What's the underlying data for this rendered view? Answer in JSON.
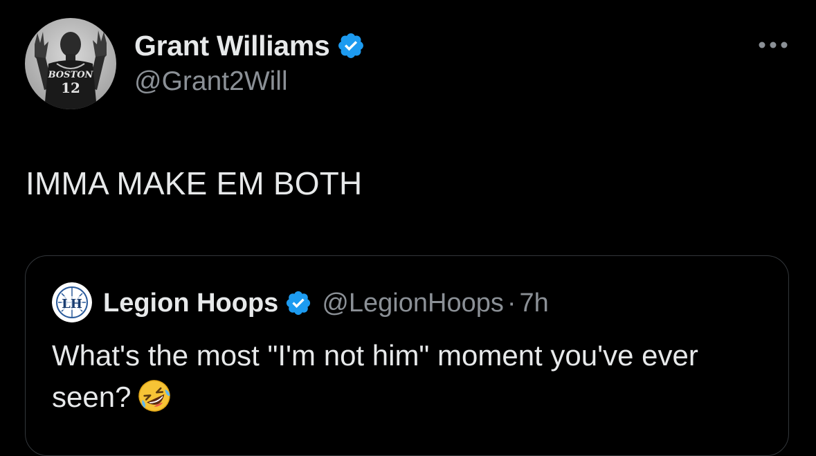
{
  "tweet": {
    "author": {
      "display_name": "Grant Williams",
      "handle": "@Grant2Will",
      "verified": true,
      "avatar_jersey_text": "BOSTON",
      "avatar_jersey_number": "12"
    },
    "text": "IMMA MAKE EM BOTH",
    "more_icon": "more-horizontal-icon"
  },
  "quoted_tweet": {
    "author": {
      "display_name": "Legion Hoops",
      "handle": "@LegionHoops",
      "verified": true,
      "avatar_logo_text": "LH"
    },
    "separator": "·",
    "time": "7h",
    "text": "What's the most \"I'm not him\" moment you've ever seen?",
    "emoji": "rolling-on-the-floor-laughing-emoji"
  },
  "colors": {
    "background": "#000000",
    "primary_text": "#e7e9ea",
    "secondary_text": "#8b9096",
    "verified_blue": "#1d9bf0",
    "border": "#33373b"
  }
}
